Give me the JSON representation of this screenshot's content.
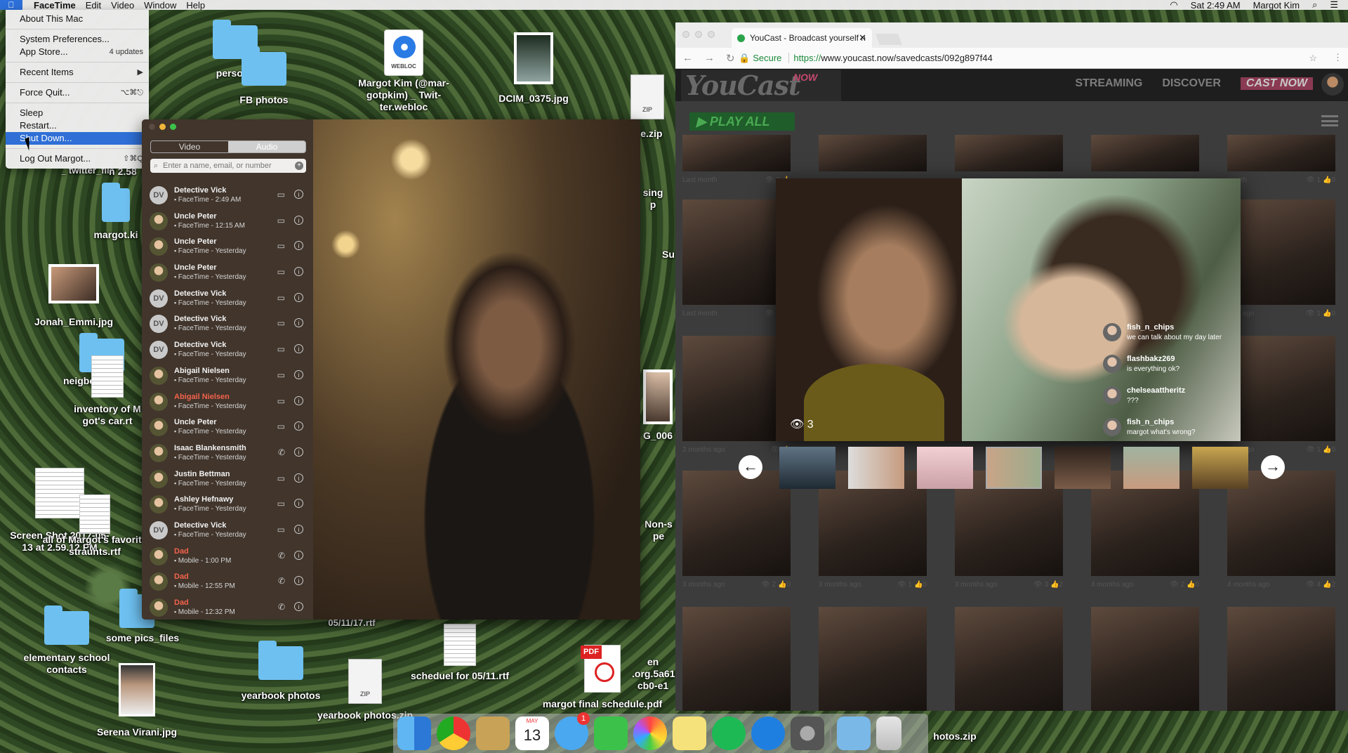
{
  "menubar": {
    "app": "FaceTime",
    "menus": [
      "Edit",
      "Video",
      "Window",
      "Help"
    ],
    "clock": "Sat 2:49 AM",
    "user": "Margot Kim"
  },
  "apple_menu": {
    "items": [
      {
        "label": "About This Mac",
        "shortcut": ""
      },
      {
        "label": "System Preferences...",
        "shortcut": ""
      },
      {
        "label": "App Store...",
        "shortcut": "4 updates"
      },
      {
        "label": "Recent Items",
        "shortcut": "▶"
      },
      {
        "label": "Force Quit...",
        "shortcut": "⌥⌘⎋"
      },
      {
        "label": "Sleep",
        "shortcut": ""
      },
      {
        "label": "Restart...",
        "shortcut": ""
      },
      {
        "label": "Shut Down...",
        "shortcut": ""
      },
      {
        "label": "Log Out Margot...",
        "shortcut": "⇧⌘Q"
      }
    ]
  },
  "desktop": {
    "personal": "persona",
    "fb_photos": "FB photos",
    "webloc": "Margot Kim (@mar-gotpkim) _ Twit-ter.webloc",
    "webloc_badge": "WEBLOC",
    "dcim": "DCIM_0375.jpg",
    "zip_partial": "ive.zip",
    "twitter_partial": "_ twitter_file",
    "margot_ki": "margot.ki",
    "jonah": "Jonah_Emmi.jpg",
    "neighbor": "neigbo",
    "inventory": "inventory of M got's car.rt",
    "screenshot": "Screen Shot 2017-05-13 at 2.59.12 PM",
    "all_margot": "all of Margot's favorite",
    "restaurants": "straunts.rtf",
    "elementary": "elementary school contacts",
    "some_pics": "some pics_files",
    "serena": "Serena Virani.jpg",
    "yearbook_photos": "yearbook photos",
    "yearbook_zip": "yearbook photos.zip",
    "sched": "scheduel for 05/11.rtf",
    "sched_partial": "05/11/17.rtf",
    "pdf": "margot final schedule.pdf",
    "pdf_badge": "PDF",
    "org": "en .org.5a61 cb0-e1",
    "photos_zip": "hotos.zip",
    "sing": "sing p",
    "su": "Su",
    "g_006": "G_006",
    "non_s": "Non-s pe",
    "n_partial": "n 2.58",
    "zip_badge": "ZIP"
  },
  "facetime": {
    "tab_video": "Video",
    "tab_audio": "Audio",
    "search_placeholder": "Enter a name, email, or number",
    "calls": [
      {
        "initials": "DV",
        "name": "Detective Vick",
        "sub": "FaceTime - 2:49 AM",
        "type": "video",
        "missed": false
      },
      {
        "initials": "",
        "name": "Uncle Peter",
        "sub": "FaceTime - 12:15 AM",
        "type": "video",
        "missed": false
      },
      {
        "initials": "",
        "name": "Uncle Peter",
        "sub": "FaceTime - Yesterday",
        "type": "video",
        "missed": false
      },
      {
        "initials": "",
        "name": "Uncle Peter",
        "sub": "FaceTime - Yesterday",
        "type": "video",
        "missed": false
      },
      {
        "initials": "DV",
        "name": "Detective Vick",
        "sub": "FaceTime - Yesterday",
        "type": "video",
        "missed": false
      },
      {
        "initials": "DV",
        "name": "Detective Vick",
        "sub": "FaceTime - Yesterday",
        "type": "video",
        "missed": false
      },
      {
        "initials": "DV",
        "name": "Detective Vick",
        "sub": "FaceTime - Yesterday",
        "type": "video",
        "missed": false
      },
      {
        "initials": "",
        "name": "Abigail Nielsen",
        "sub": "FaceTime - Yesterday",
        "type": "video",
        "missed": false
      },
      {
        "initials": "",
        "name": "Abigail Nielsen",
        "sub": "FaceTime - Yesterday",
        "type": "video",
        "missed": true
      },
      {
        "initials": "",
        "name": "Uncle Peter",
        "sub": "FaceTime - Yesterday",
        "type": "video",
        "missed": false
      },
      {
        "initials": "",
        "name": "Isaac Blankensmith",
        "sub": "FaceTime - Yesterday",
        "type": "audio",
        "missed": false
      },
      {
        "initials": "",
        "name": "Justin Bettman",
        "sub": "FaceTime - Yesterday",
        "type": "video",
        "missed": false
      },
      {
        "initials": "",
        "name": "Ashley Hefnawy",
        "sub": "FaceTime - Yesterday",
        "type": "video",
        "missed": false
      },
      {
        "initials": "DV",
        "name": "Detective Vick",
        "sub": "FaceTime - Yesterday",
        "type": "video",
        "missed": false
      },
      {
        "initials": "",
        "name": "Dad",
        "sub": "Mobile - 1:00 PM",
        "type": "audio",
        "missed": true
      },
      {
        "initials": "",
        "name": "Dad",
        "sub": "Mobile - 12:55 PM",
        "type": "audio",
        "missed": true
      },
      {
        "initials": "",
        "name": "Dad",
        "sub": "Mobile - 12:32 PM",
        "type": "audio",
        "missed": true
      }
    ]
  },
  "browser": {
    "tab_title": "YouCast - Broadcast yourself n",
    "secure": "Secure",
    "url_scheme": "https://",
    "url_rest": "www.youcast.now/savedcasts/092g897f44"
  },
  "youcast": {
    "logo": "YouCast",
    "logo_now": "NOW",
    "nav": [
      "STREAMING",
      "DISCOVER"
    ],
    "cast_now": "CAST NOW",
    "play_all": "PLAY ALL",
    "view_count": "3",
    "captions": [
      {
        "age": "Last month",
        "views": "3",
        "likes": ""
      },
      {
        "age": "",
        "views": "",
        "likes": ""
      },
      {
        "age": "",
        "views": "",
        "likes": ""
      },
      {
        "age": "",
        "views": "",
        "likes": ""
      },
      {
        "age": "month",
        "views": "1",
        "likes": "0"
      },
      {
        "age": "Last month",
        "views": "1",
        "likes": ""
      },
      {
        "age": "nths ago",
        "views": "1",
        "likes": "0"
      },
      {
        "age": "2 months ago",
        "views": "",
        "likes": ""
      },
      {
        "age": "nths ago",
        "views": "1",
        "likes": "0"
      },
      {
        "age": "3 months ago",
        "views": "2",
        "likes": "0"
      },
      {
        "age": "3 months ago",
        "views": "1",
        "likes": "0"
      },
      {
        "age": "3 months ago",
        "views": "3",
        "likes": "2"
      },
      {
        "age": "4 months ago",
        "views": "2",
        "likes": "0"
      },
      {
        "age": "4 months ago",
        "views": "4",
        "likes": "2"
      }
    ],
    "comments": [
      {
        "user": "fish_n_chips",
        "text": "we can talk about my day later"
      },
      {
        "user": "flashbakz269",
        "text": "is everything ok?"
      },
      {
        "user": "chelseaattheritz",
        "text": "???"
      },
      {
        "user": "fish_n_chips",
        "text": "margot what's wrong?"
      }
    ]
  },
  "dock": {
    "calendar_month": "MAY",
    "calendar_day": "13",
    "messages_badge": "1"
  }
}
